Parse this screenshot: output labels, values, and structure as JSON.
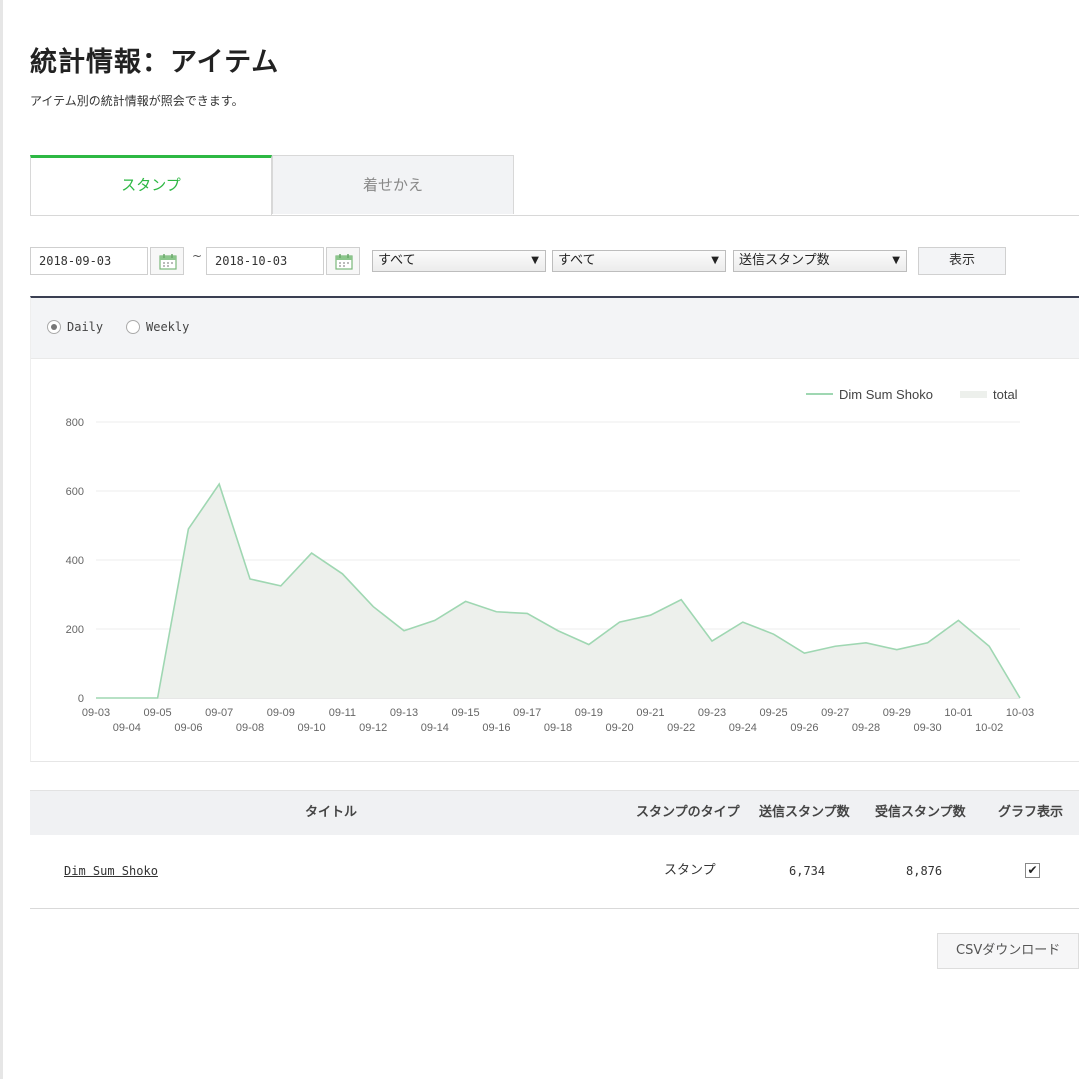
{
  "page": {
    "title": "統計情報：アイテム",
    "subtitle": "アイテム別の統計情報が照会できます。"
  },
  "tabs": [
    {
      "label": "スタンプ",
      "active": true
    },
    {
      "label": "着せかえ",
      "active": false
    }
  ],
  "filters": {
    "start_date": "2018-09-03",
    "separator": "~",
    "end_date": "2018-10-03",
    "select1": "すべて",
    "select2": "すべて",
    "select3": "送信スタンプ数",
    "show_button": "表示"
  },
  "period": {
    "daily": "Daily",
    "weekly": "Weekly",
    "selected": "Daily"
  },
  "colors": {
    "accent": "#2db843",
    "series_line": "#9fd7b2",
    "series_fill": "#edf0ec"
  },
  "chart_data": {
    "type": "area",
    "x": [
      "09-03",
      "09-04",
      "09-05",
      "09-06",
      "09-07",
      "09-08",
      "09-09",
      "09-10",
      "09-11",
      "09-12",
      "09-13",
      "09-14",
      "09-15",
      "09-16",
      "09-17",
      "09-18",
      "09-19",
      "09-20",
      "09-21",
      "09-22",
      "09-23",
      "09-24",
      "09-25",
      "09-26",
      "09-27",
      "09-28",
      "09-29",
      "09-30",
      "10-01",
      "10-02",
      "10-03"
    ],
    "series": [
      {
        "name": "Dim Sum Shoko",
        "values": [
          0,
          0,
          0,
          490,
          620,
          345,
          325,
          420,
          360,
          265,
          195,
          225,
          280,
          250,
          245,
          195,
          155,
          220,
          240,
          285,
          165,
          220,
          185,
          130,
          150,
          160,
          140,
          160,
          225,
          150,
          0
        ]
      },
      {
        "name": "total",
        "values": [
          0,
          0,
          0,
          490,
          620,
          345,
          325,
          420,
          360,
          265,
          195,
          225,
          280,
          250,
          245,
          195,
          155,
          220,
          240,
          285,
          165,
          220,
          185,
          130,
          150,
          160,
          140,
          160,
          225,
          150,
          0
        ]
      }
    ],
    "yticks": [
      0,
      200,
      400,
      600,
      800
    ],
    "ylim": [
      0,
      800
    ],
    "grid": true,
    "legend": "top-right"
  },
  "table": {
    "headers": {
      "title": "タイトル",
      "type": "スタンプのタイプ",
      "sent": "送信スタンプ数",
      "received": "受信スタンプ数",
      "graph": "グラフ表示"
    },
    "rows": [
      {
        "title": "Dim Sum Shoko",
        "type": "スタンプ",
        "sent": "6,734",
        "received": "8,876",
        "graph": true
      }
    ]
  },
  "csv_button": "CSVダウンロード"
}
